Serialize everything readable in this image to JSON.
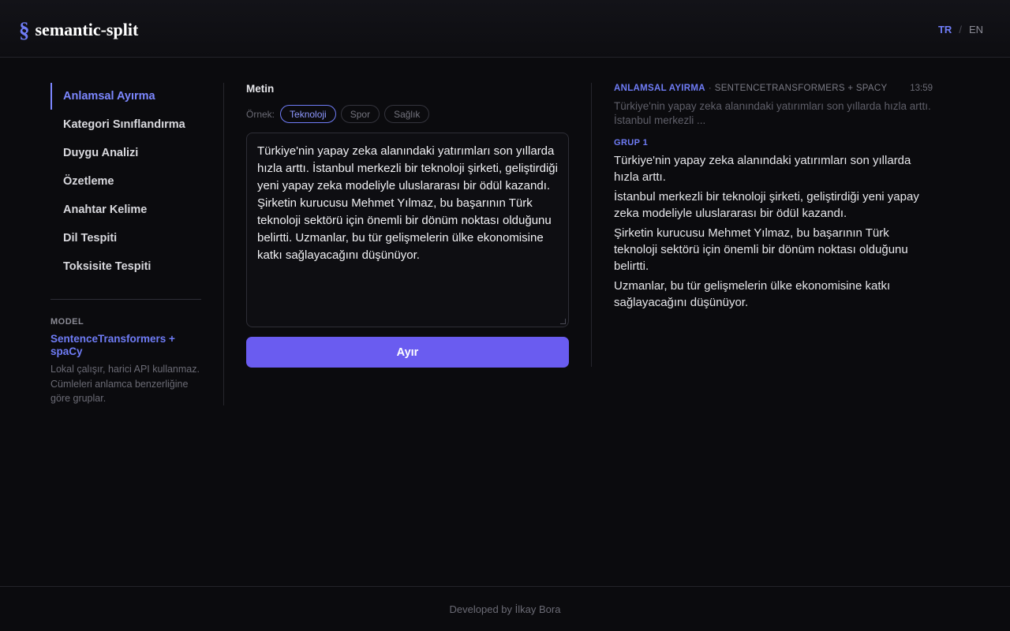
{
  "header": {
    "logo_mark": "§",
    "logo_text": "semantic-split",
    "lang_tr": "TR",
    "lang_sep": "/",
    "lang_en": "EN"
  },
  "sidebar": {
    "items": [
      {
        "label": "Anlamsal Ayırma",
        "active": true
      },
      {
        "label": "Kategori Sınıflandırma",
        "active": false
      },
      {
        "label": "Duygu Analizi",
        "active": false
      },
      {
        "label": "Özetleme",
        "active": false
      },
      {
        "label": "Anahtar Kelime",
        "active": false
      },
      {
        "label": "Dil Tespiti",
        "active": false
      },
      {
        "label": "Toksisite Tespiti",
        "active": false
      }
    ],
    "model_label": "MODEL",
    "model_name": "SentenceTransformers + spaCy",
    "model_desc": "Lokal çalışır, harici API kullanmaz. Cümleleri anlamca benzerliğine göre gruplar."
  },
  "editor": {
    "label": "Metin",
    "examples_label": "Örnek:",
    "examples": [
      "Teknoloji",
      "Spor",
      "Sağlık"
    ],
    "active_example": "Teknoloji",
    "text": "Türkiye'nin yapay zeka alanındaki yatırımları son yıllarda hızla arttı. İstanbul merkezli bir teknoloji şirketi, geliştirdiği yeni yapay zeka modeliyle uluslararası bir ödül kazandı. Şirketin kurucusu Mehmet Yılmaz, bu başarının Türk teknoloji sektörü için önemli bir dönüm noktası olduğunu belirtti. Uzmanlar, bu tür gelişmelerin ülke ekonomisine katkı sağlayacağını düşünüyor.",
    "button_label": "Ayır"
  },
  "result": {
    "mode": "ANLAMSAL AYIRMA",
    "dot": "·",
    "model": "SENTENCETRANSFORMERS + SPACY",
    "time": "13:59",
    "preview": "Türkiye'nin yapay zeka alanındaki yatırımları son yıllarda hızla arttı. İstanbul merkezli ...",
    "groups": [
      {
        "label": "GRUP 1",
        "sentences": [
          "Türkiye'nin yapay zeka alanındaki yatırımları son yıllarda hızla arttı.",
          "İstanbul merkezli bir teknoloji şirketi, geliştirdiği yeni yapay zeka modeliyle uluslararası bir ödül kazandı.",
          "Şirketin kurucusu Mehmet Yılmaz, bu başarının Türk teknoloji sektörü için önemli bir dönüm noktası olduğunu belirtti.",
          "Uzmanlar, bu tür gelişmelerin ülke ekonomisine katkı sağlayacağını düşünüyor."
        ]
      }
    ]
  },
  "footer": {
    "text": "Developed by İlkay Bora"
  },
  "colors": {
    "accent": "#6f7cf6",
    "button": "#6a5cf0",
    "background": "#0b0b0e"
  }
}
